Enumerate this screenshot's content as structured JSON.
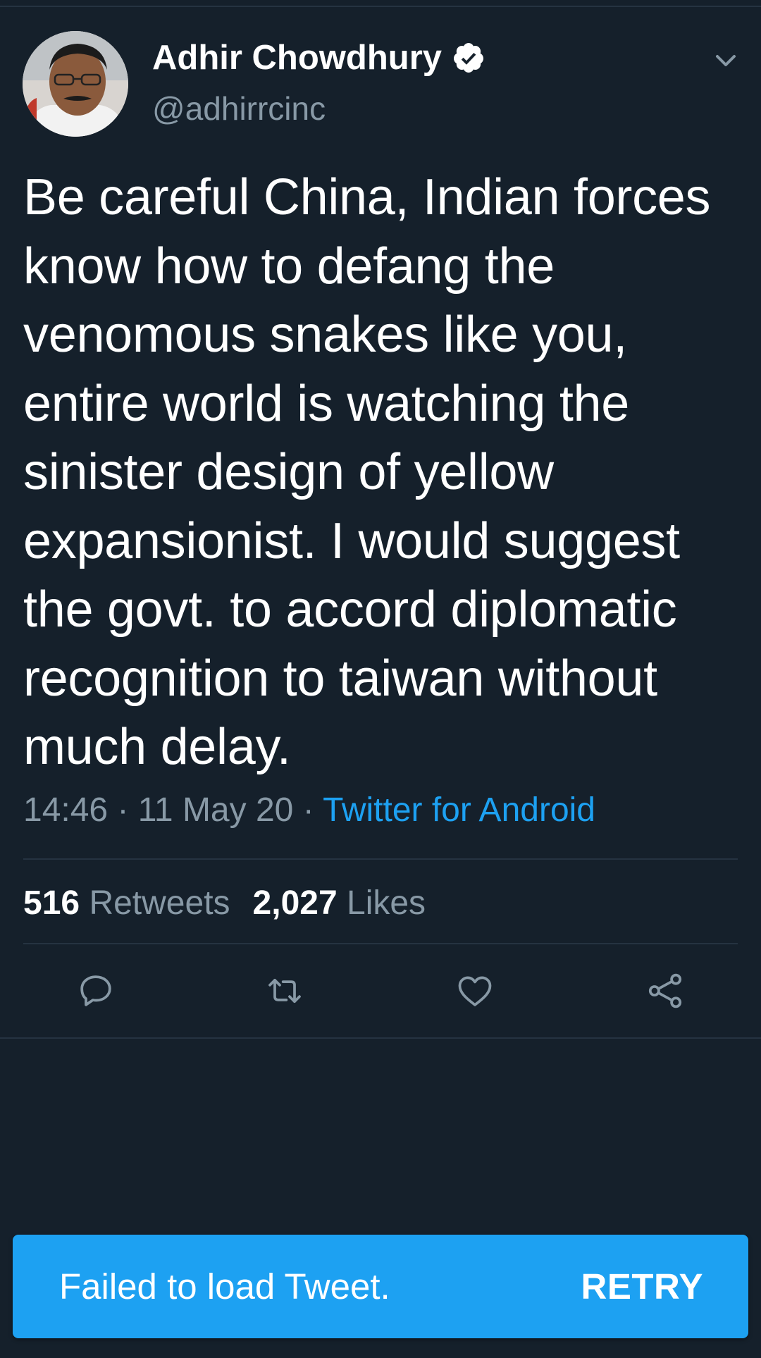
{
  "tweet": {
    "display_name": "Adhir Chowdhury",
    "verified_icon": "verified-badge-icon",
    "handle": "@adhirrcinc",
    "text": "Be careful China, Indian forces know how to defang the venomous snakes like you, entire world is watching the sinister design of yellow expansionist. I would suggest the govt. to accord diplomatic recognition to taiwan without much delay.",
    "time": "14:46",
    "separator": " · ",
    "date": "11 May 20",
    "source": "Twitter for Android"
  },
  "stats": {
    "retweets_count": "516",
    "retweets_label": "Retweets",
    "likes_count": "2,027",
    "likes_label": "Likes"
  },
  "actions": [
    "reply-icon",
    "retweet-icon",
    "like-icon",
    "share-icon"
  ],
  "toast": {
    "message": "Failed to load Tweet.",
    "retry_label": "RETRY"
  },
  "colors": {
    "background": "#15202b",
    "secondary_text": "#8899a6",
    "accent": "#1da1f2",
    "divider": "#253341"
  }
}
